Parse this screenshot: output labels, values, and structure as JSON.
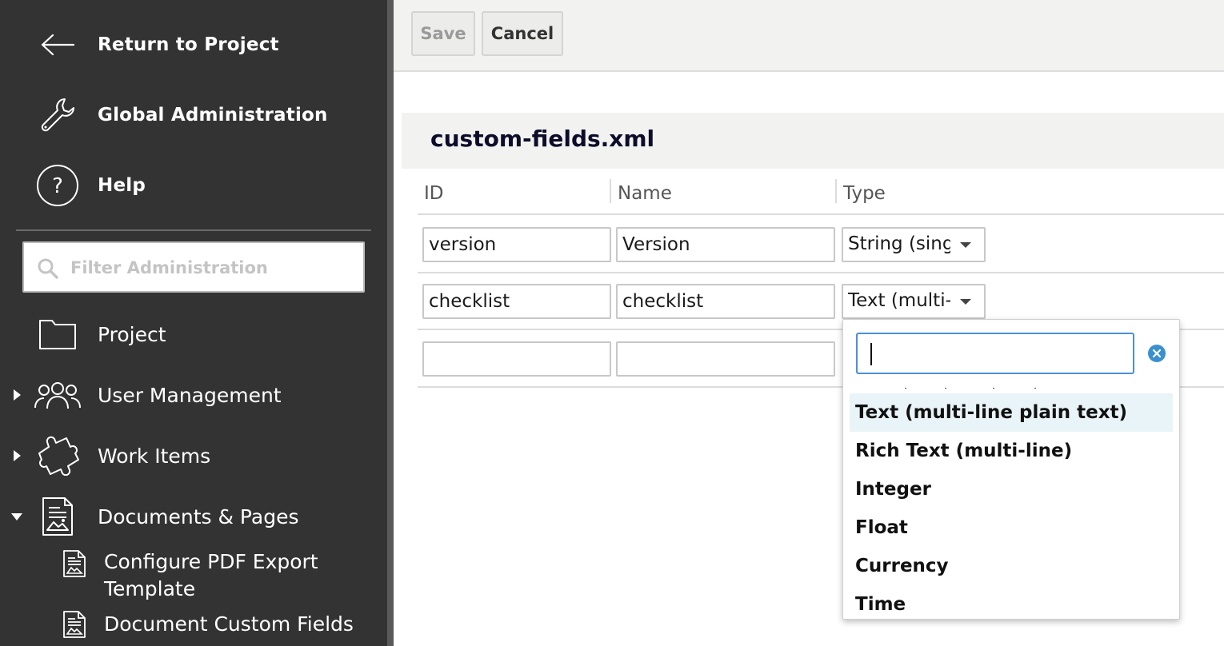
{
  "sidebar": {
    "return_label": "Return to Project",
    "global_admin_label": "Global Administration",
    "help_label": "Help",
    "filter_placeholder": "Filter Administration",
    "items": [
      {
        "label": "Project",
        "icon": "folder-icon"
      },
      {
        "label": "User Management",
        "icon": "users-icon",
        "expanded": false
      },
      {
        "label": "Work Items",
        "icon": "puzzle-icon",
        "expanded": false
      },
      {
        "label": "Documents & Pages",
        "icon": "document-icon",
        "expanded": true
      }
    ],
    "sub_items": [
      {
        "label": "Configure PDF Export Template",
        "icon": "document-icon"
      },
      {
        "label": "Document Custom Fields",
        "icon": "document-icon"
      }
    ]
  },
  "toolbar": {
    "save_label": "Save",
    "cancel_label": "Cancel"
  },
  "file": {
    "title": "custom-fields.xml"
  },
  "table": {
    "columns": [
      "ID",
      "Name",
      "Type"
    ],
    "rows": [
      {
        "id": "version",
        "name": "Version",
        "type": "String (single-line)"
      },
      {
        "id": "checklist",
        "name": "checklist",
        "type": "Text (multi-line plain text)"
      },
      {
        "id": "",
        "name": "",
        "type": ""
      }
    ]
  },
  "dropdown": {
    "search_value": "",
    "options": [
      "Text (multi-line plain text)",
      "Rich Text (multi-line)",
      "Integer",
      "Float",
      "Currency",
      "Time"
    ],
    "highlighted_index": 0
  },
  "colors": {
    "sidebar_bg": "#333333",
    "highlight": "#e8f4f7",
    "focus_border": "#4a90d9",
    "clear_icon": "#3a8fd0"
  }
}
